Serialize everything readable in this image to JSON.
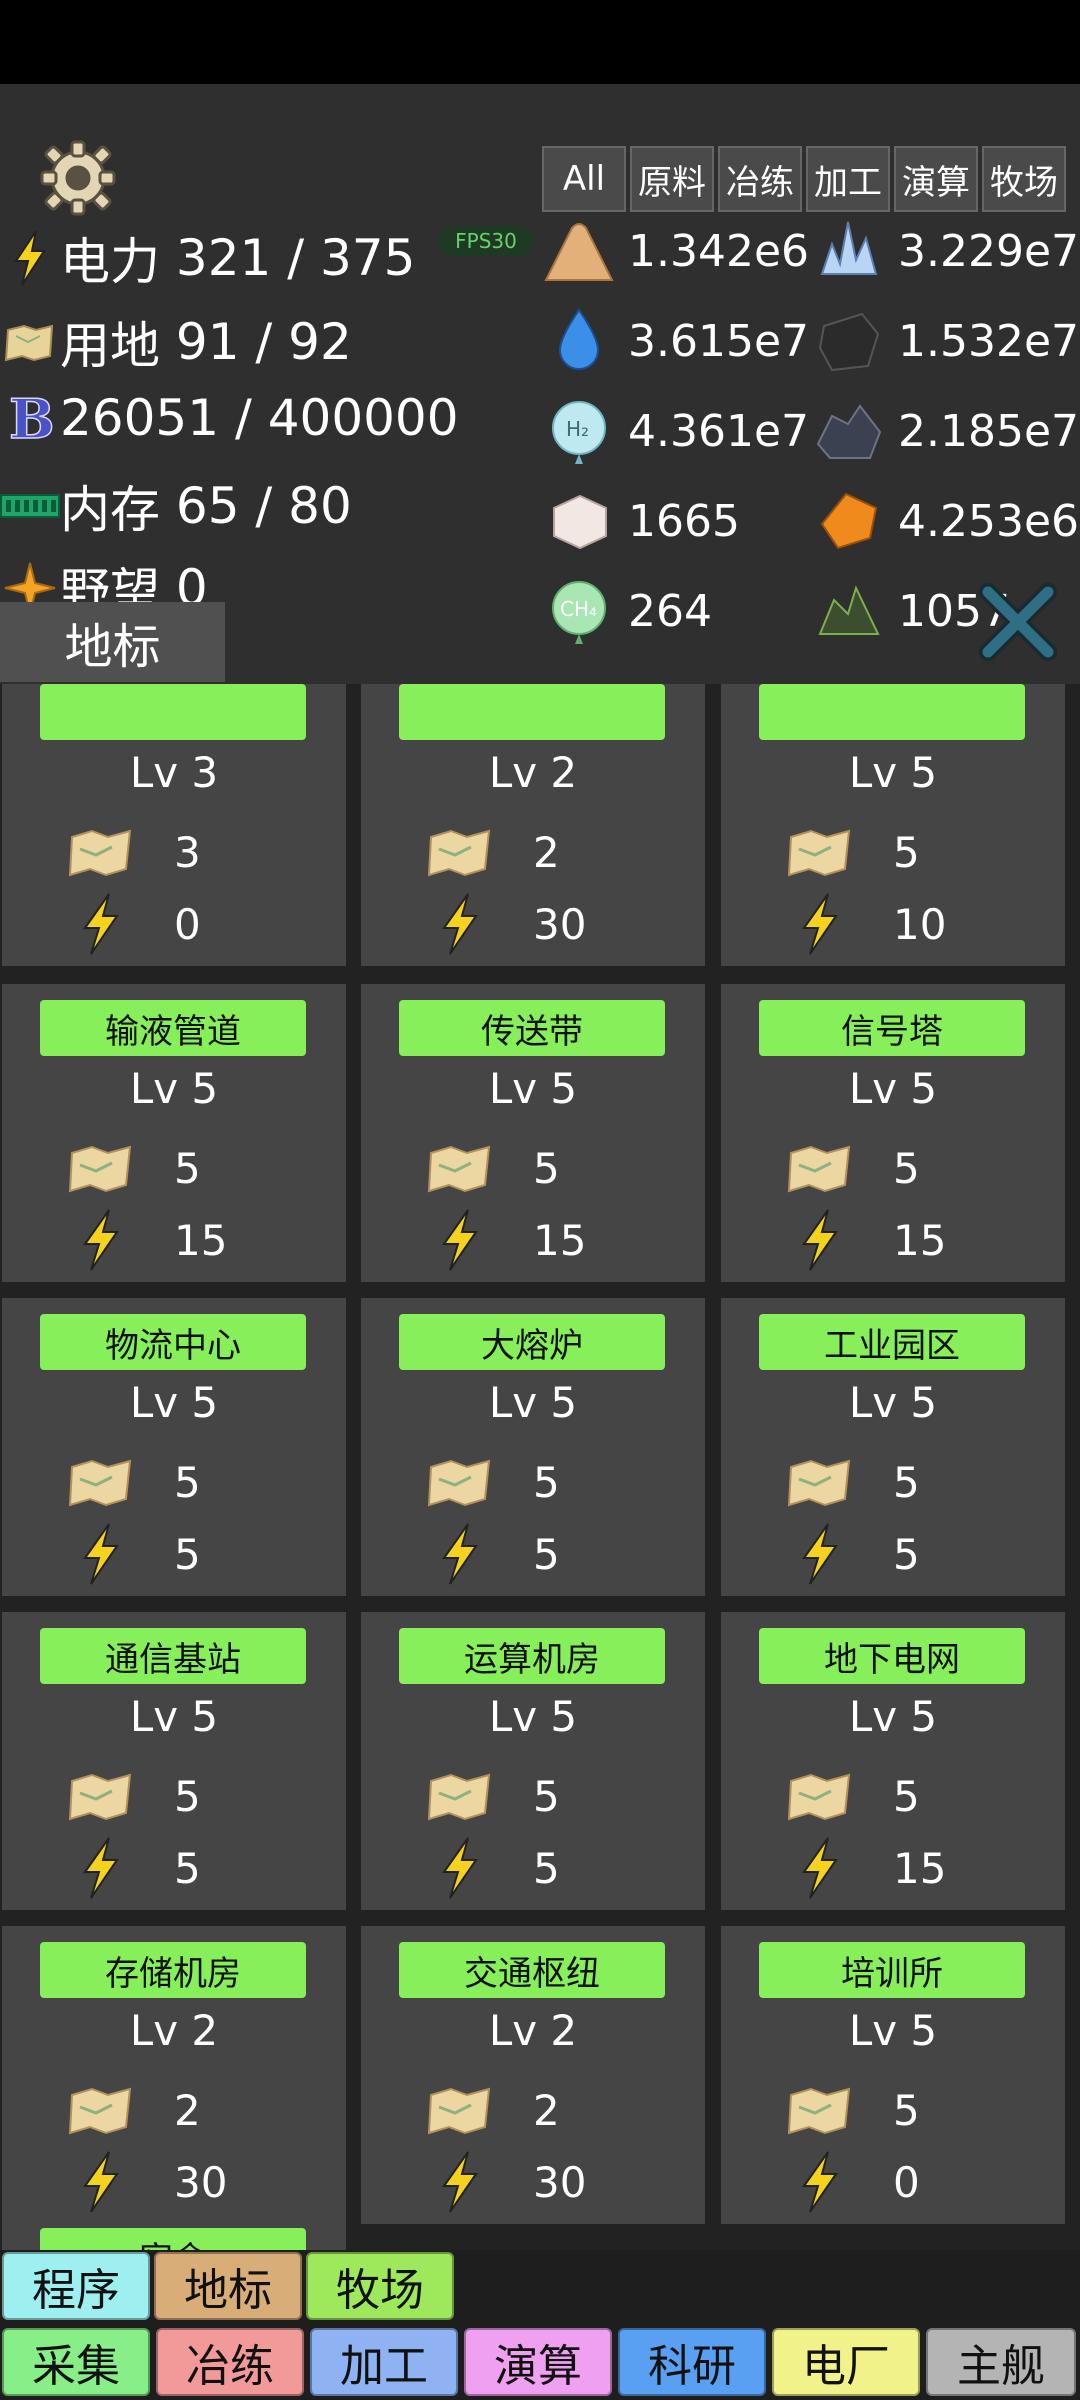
{
  "hud": {
    "power": {
      "label": "电力",
      "value": "321 / 375"
    },
    "land": {
      "label": "用地",
      "value": "91 / 92"
    },
    "bits": {
      "value": "26051 / 400000"
    },
    "memory": {
      "label": "内存",
      "value": "65 / 80"
    },
    "ambition": {
      "label": "野望",
      "value": "0"
    },
    "fps": "FPS30"
  },
  "resource_tabs": [
    "All",
    "原料",
    "冶练",
    "加工",
    "演算",
    "牧场"
  ],
  "resources": [
    {
      "icon": "sand-pile-icon",
      "value": "1.342e6"
    },
    {
      "icon": "crystal-cluster-icon",
      "value": "3.229e7"
    },
    {
      "icon": "water-drop-icon",
      "value": "3.615e7"
    },
    {
      "icon": "coal-lump-icon",
      "value": "1.532e7"
    },
    {
      "icon": "hydrogen-bubble-icon",
      "value": "4.361e7",
      "badge": "H₂"
    },
    {
      "icon": "ore-rocks-icon",
      "value": "2.185e7"
    },
    {
      "icon": "salt-cube-icon",
      "value": "1665"
    },
    {
      "icon": "amber-gem-icon",
      "value": "4.253e6"
    },
    {
      "icon": "methane-bubble-icon",
      "value": "264",
      "badge": "CH₄"
    },
    {
      "icon": "mossy-rock-icon",
      "value": "1057"
    }
  ],
  "section_tab": "地标",
  "buildings": [
    {
      "name": "",
      "level": "Lv 3",
      "land": "3",
      "power": "0"
    },
    {
      "name": "",
      "level": "Lv 2",
      "land": "2",
      "power": "30"
    },
    {
      "name": "",
      "level": "Lv 5",
      "land": "5",
      "power": "10"
    },
    {
      "name": "输液管道",
      "level": "Lv 5",
      "land": "5",
      "power": "15"
    },
    {
      "name": "传送带",
      "level": "Lv 5",
      "land": "5",
      "power": "15"
    },
    {
      "name": "信号塔",
      "level": "Lv 5",
      "land": "5",
      "power": "15"
    },
    {
      "name": "物流中心",
      "level": "Lv 5",
      "land": "5",
      "power": "5"
    },
    {
      "name": "大熔炉",
      "level": "Lv 5",
      "land": "5",
      "power": "5"
    },
    {
      "name": "工业园区",
      "level": "Lv 5",
      "land": "5",
      "power": "5"
    },
    {
      "name": "通信基站",
      "level": "Lv 5",
      "land": "5",
      "power": "5"
    },
    {
      "name": "运算机房",
      "level": "Lv 5",
      "land": "5",
      "power": "5"
    },
    {
      "name": "地下电网",
      "level": "Lv 5",
      "land": "5",
      "power": "15"
    },
    {
      "name": "存储机房",
      "level": "Lv 2",
      "land": "2",
      "power": "30"
    },
    {
      "name": "交通枢纽",
      "level": "Lv 2",
      "land": "2",
      "power": "30"
    },
    {
      "name": "培训所",
      "level": "Lv 5",
      "land": "5",
      "power": "0"
    },
    {
      "name": "宿舍",
      "level": "",
      "land": "",
      "power": ""
    }
  ],
  "bottom_nav": {
    "row1": [
      {
        "label": "程序",
        "color": "#9ef0f0"
      },
      {
        "label": "地标",
        "color": "#d9ad78"
      },
      {
        "label": "牧场",
        "color": "#9ee85c"
      }
    ],
    "row2": [
      {
        "label": "采集",
        "color": "#88ee88"
      },
      {
        "label": "冶练",
        "color": "#f29a9a"
      },
      {
        "label": "加工",
        "color": "#8fb2f2"
      },
      {
        "label": "演算",
        "color": "#f0a0f0"
      },
      {
        "label": "科研",
        "color": "#5aa0f2"
      },
      {
        "label": "电厂",
        "color": "#f2f28a"
      },
      {
        "label": "主舰",
        "color": "#b4b4b4"
      }
    ]
  }
}
